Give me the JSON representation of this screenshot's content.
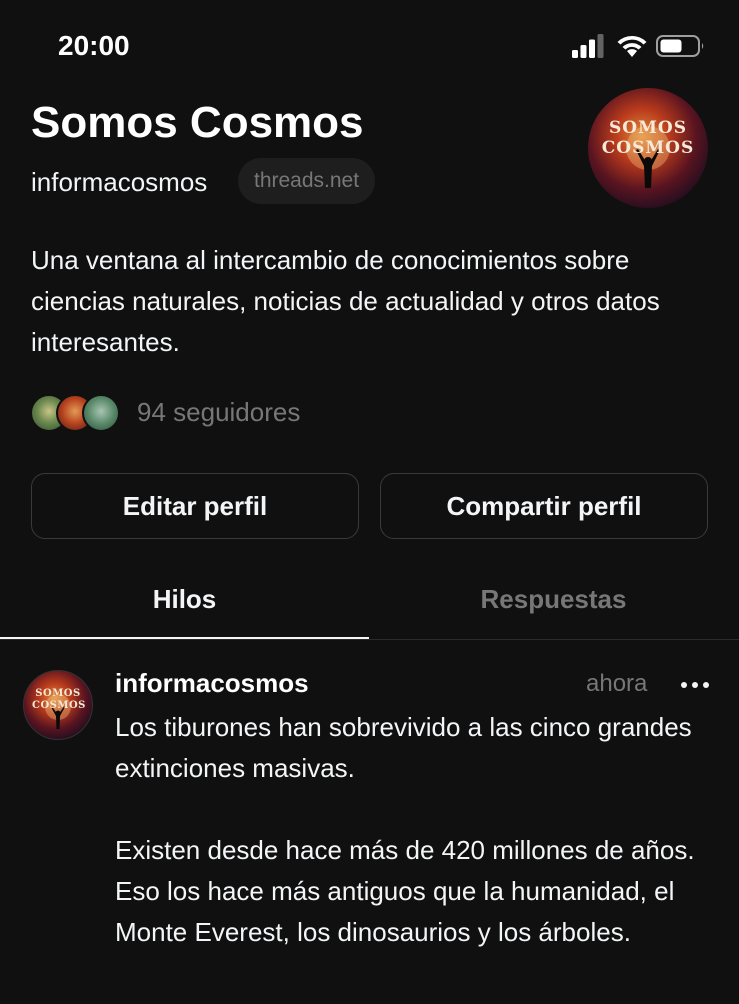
{
  "status_bar": {
    "time": "20:00",
    "icons": [
      "signal-icon",
      "wifi-icon",
      "battery-icon"
    ]
  },
  "profile": {
    "name": "Somos Cosmos",
    "handle": "informacosmos",
    "domain_badge": "threads.net",
    "avatar_logo": "SOMOS COSMOS",
    "bio": "Una ventana al intercambio de conocimientos sobre ciencias naturales, noticias de actualidad y otros datos interesantes.",
    "followers_label": "94 seguidores"
  },
  "actions": {
    "edit_label": "Editar perfil",
    "share_label": "Compartir perfil"
  },
  "tabs": [
    {
      "label": "Hilos",
      "active": true
    },
    {
      "label": "Respuestas",
      "active": false
    }
  ],
  "post": {
    "author": "informacosmos",
    "time": "ahora",
    "paragraphs": [
      "Los tiburones han sobrevivido a las cinco grandes extinciones masivas.",
      "Existen desde hace más de 420 millones de años. Eso los hace más antiguos que la humanidad, el Monte Everest, los dinosaurios y los árboles."
    ]
  },
  "colors": {
    "background": "#101010",
    "text_primary": "#f3f5f7",
    "text_secondary": "#777777",
    "border": "#3a3a3a"
  }
}
